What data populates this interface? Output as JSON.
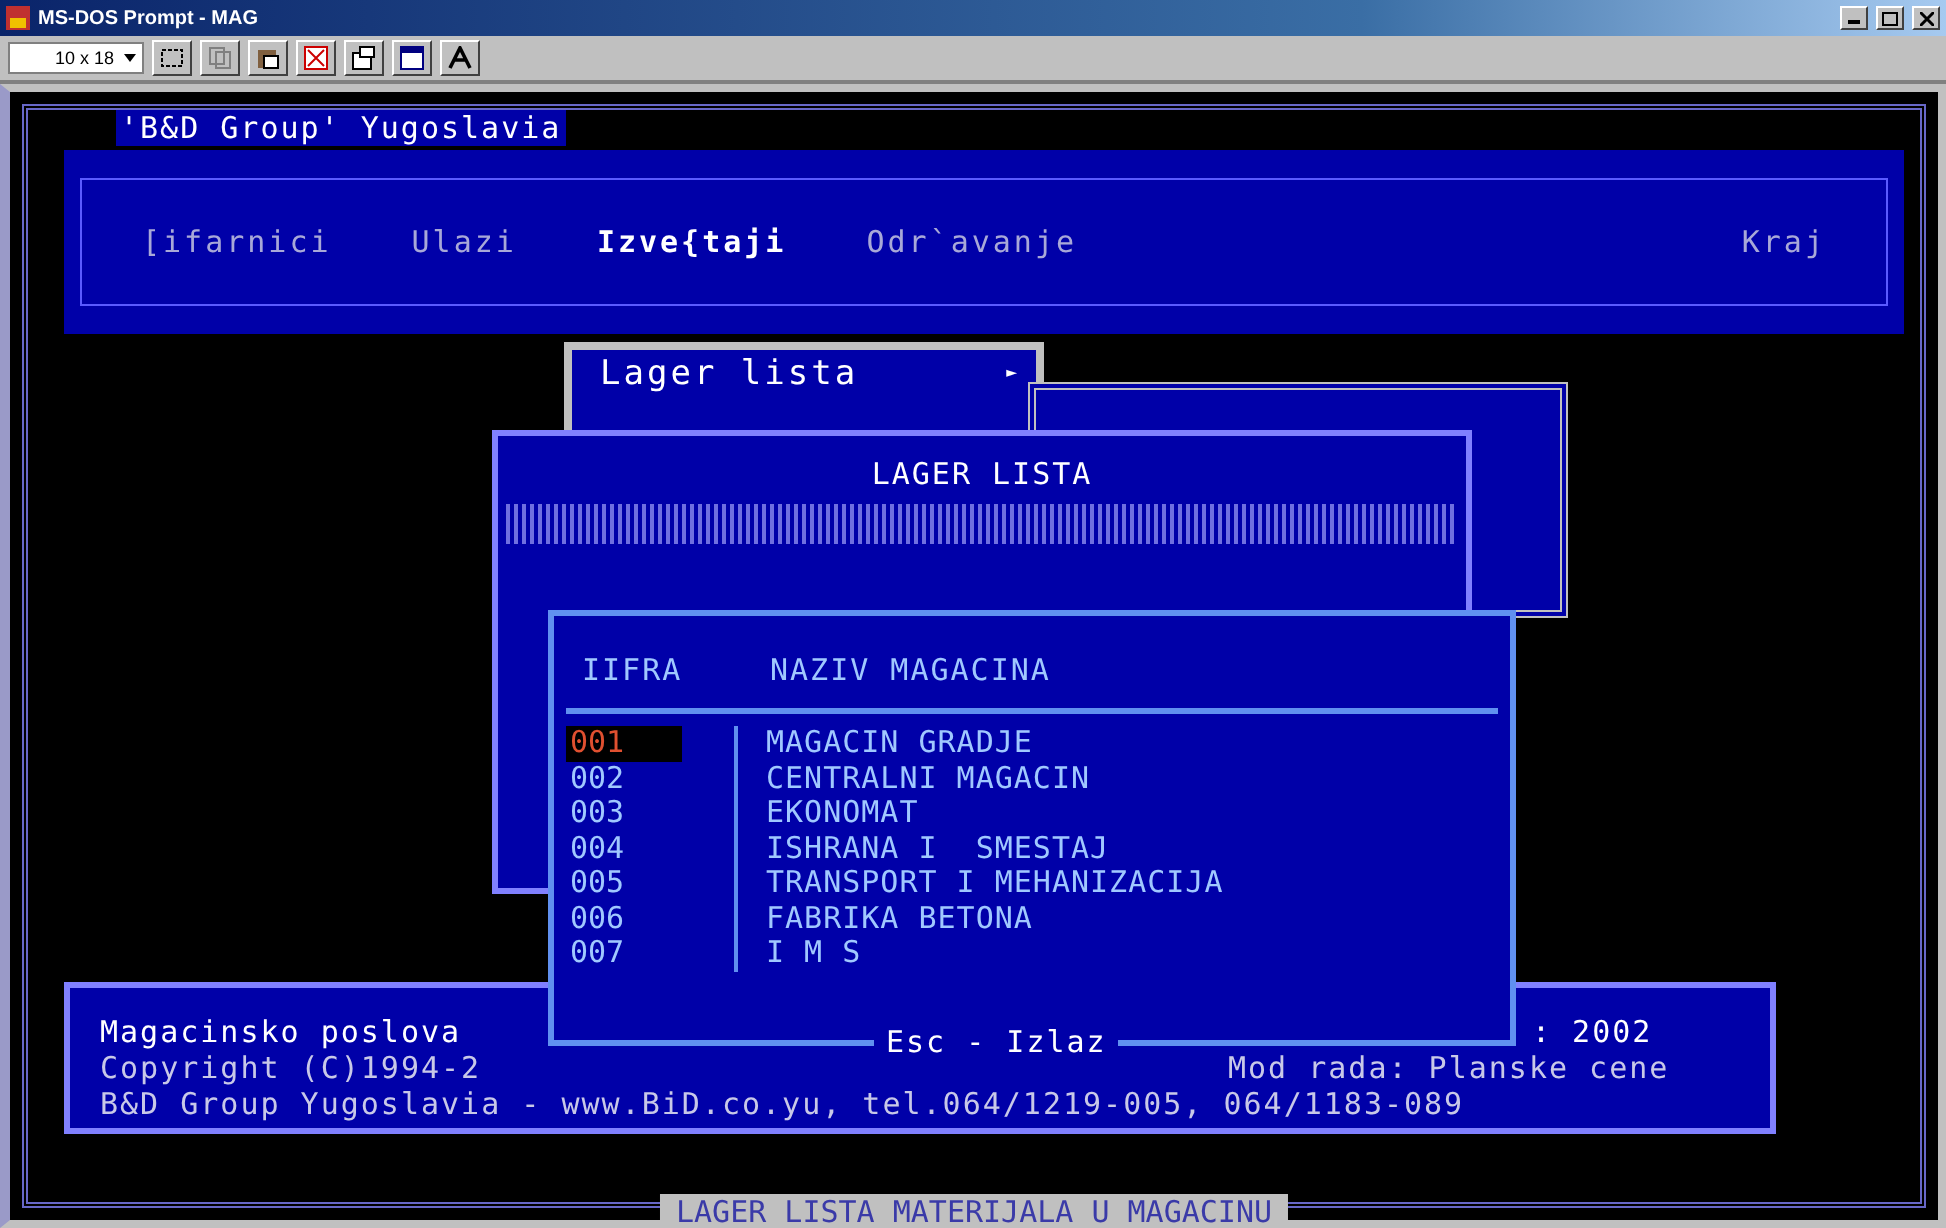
{
  "window": {
    "title": "MS-DOS Prompt - MAG"
  },
  "toolbar": {
    "font_size": "10 x 18"
  },
  "app_title": "'B&D Group' Yugoslavia",
  "menu": [
    {
      "label": "[ifarnici",
      "selected": false
    },
    {
      "label": "Ulazi",
      "selected": false
    },
    {
      "label": "Izve{taji",
      "selected": true
    },
    {
      "label": "Odr`avanje",
      "selected": false
    },
    {
      "label": "Kraj",
      "selected": false
    }
  ],
  "submenu": {
    "label": "Lager lista",
    "arrow": "►"
  },
  "dialog": {
    "title": "LAGER LISTA"
  },
  "list": {
    "columns": [
      "IIFRA",
      "NAZIV MAGACINA"
    ],
    "rows": [
      {
        "code": "001",
        "name": "MAGACIN GRADJE",
        "selected": true
      },
      {
        "code": "002",
        "name": "CENTRALNI MAGACIN",
        "selected": false
      },
      {
        "code": "003",
        "name": "EKONOMAT",
        "selected": false
      },
      {
        "code": "004",
        "name": "ISHRANA I  SMESTAJ",
        "selected": false
      },
      {
        "code": "005",
        "name": "TRANSPORT I MEHANIZACIJA",
        "selected": false
      },
      {
        "code": "006",
        "name": "FABRIKA BETONA",
        "selected": false
      },
      {
        "code": "007",
        "name": "I M S",
        "selected": false
      }
    ],
    "hint": "Esc - Izlaz"
  },
  "info": {
    "line_1": "Magacinsko poslova",
    "line_1_end": ": 2002",
    "line_2": "Copyright (C)1994-2",
    "line_2_end": "Mod rada: Planske cene",
    "line_3": "B&D Group Yugoslavia - www.BiD.co.yu, tel.064/1219-005, 064/1183-089"
  },
  "status": "LAGER LISTA MATERIJALA U MAGACINU"
}
